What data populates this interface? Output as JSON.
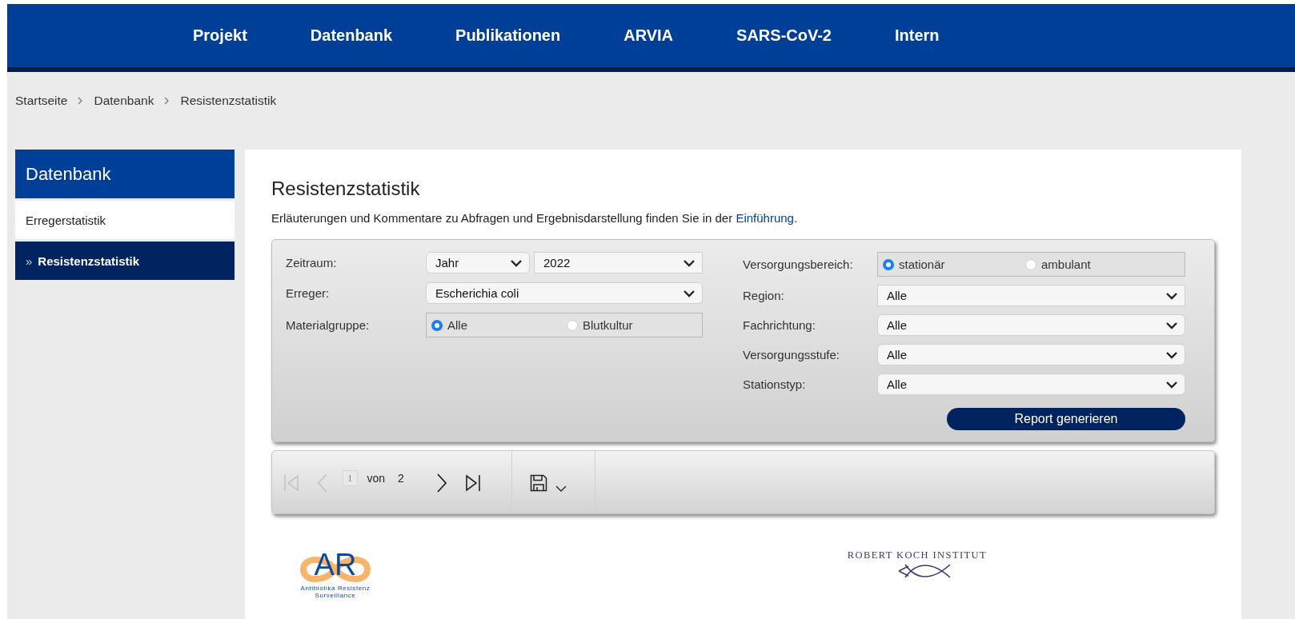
{
  "nav": [
    {
      "label": "Projekt"
    },
    {
      "label": "Datenbank"
    },
    {
      "label": "Publikationen"
    },
    {
      "label": "ARVIA"
    },
    {
      "label": "SARS-CoV-2"
    },
    {
      "label": "Intern"
    }
  ],
  "breadcrumb": [
    "Startseite",
    "Datenbank",
    "Resistenzstatistik"
  ],
  "sidebar": {
    "title": "Datenbank",
    "items": [
      {
        "label": "Erregerstatistik",
        "selected": false
      },
      {
        "label": "Resistenzstatistik",
        "selected": true,
        "marker": "»"
      }
    ]
  },
  "page": {
    "title": "Resistenzstatistik",
    "intro": "Erläuterungen und Kommentare zu Abfragen und Ergebnisdarstellung finden Sie in der",
    "link": "Einführung",
    "after_link": "."
  },
  "form": {
    "left": [
      {
        "label": "Zeitraum:",
        "kind": "pair",
        "values": [
          "Jahr",
          "2022"
        ]
      },
      {
        "label": "Erreger:",
        "kind": "select",
        "value": "Escherichia coli"
      },
      {
        "label": "Materialgruppe:",
        "kind": "radio",
        "options": [
          {
            "label": "Alle",
            "selected": true
          },
          {
            "label": "Blutkultur",
            "selected": false
          }
        ]
      }
    ],
    "right": [
      {
        "label": "Versorgungsbereich:",
        "kind": "radio",
        "options": [
          {
            "label": "stationär",
            "selected": true
          },
          {
            "label": "ambulant",
            "selected": false
          }
        ]
      },
      {
        "label": "Region:",
        "kind": "select",
        "value": "Alle"
      },
      {
        "label": "Fachrichtung:",
        "kind": "select",
        "value": "Alle"
      },
      {
        "label": "Versorgungsstufe:",
        "kind": "select",
        "value": "Alle"
      },
      {
        "label": "Stationstyp:",
        "kind": "select",
        "value": "Alle"
      }
    ],
    "button": "Report generieren"
  },
  "toolbar": {
    "page": "1",
    "of": "von",
    "total": "2",
    "first_disabled": true,
    "prev_disabled": true,
    "next_disabled": false,
    "last_disabled": false
  },
  "footer": {
    "ars_logo": {
      "mark": "AR",
      "line1": "Antibiotika Resistenz",
      "line2": "Surveillance"
    },
    "rki_logo": {
      "name": "ROBERT KOCH INSTITUT"
    }
  }
}
